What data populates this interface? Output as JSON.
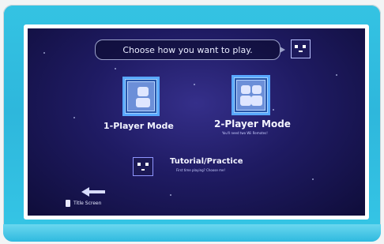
{
  "prompt": "Choose how you want to play.",
  "modes": [
    {
      "label": "1-Player Mode",
      "sub": ""
    },
    {
      "label": "2-Player Mode",
      "sub": "You'll need two Wii Remotes!"
    }
  ],
  "tutorial": {
    "label": "Tutorial/Practice",
    "sub": "First time playing? Choose me!"
  },
  "back": {
    "label": "Title Screen",
    "button": "B"
  },
  "colors": {
    "frame": "#2eb7dc",
    "screen_bg": "#1f1b63",
    "icon_border": "#59a8ff"
  }
}
